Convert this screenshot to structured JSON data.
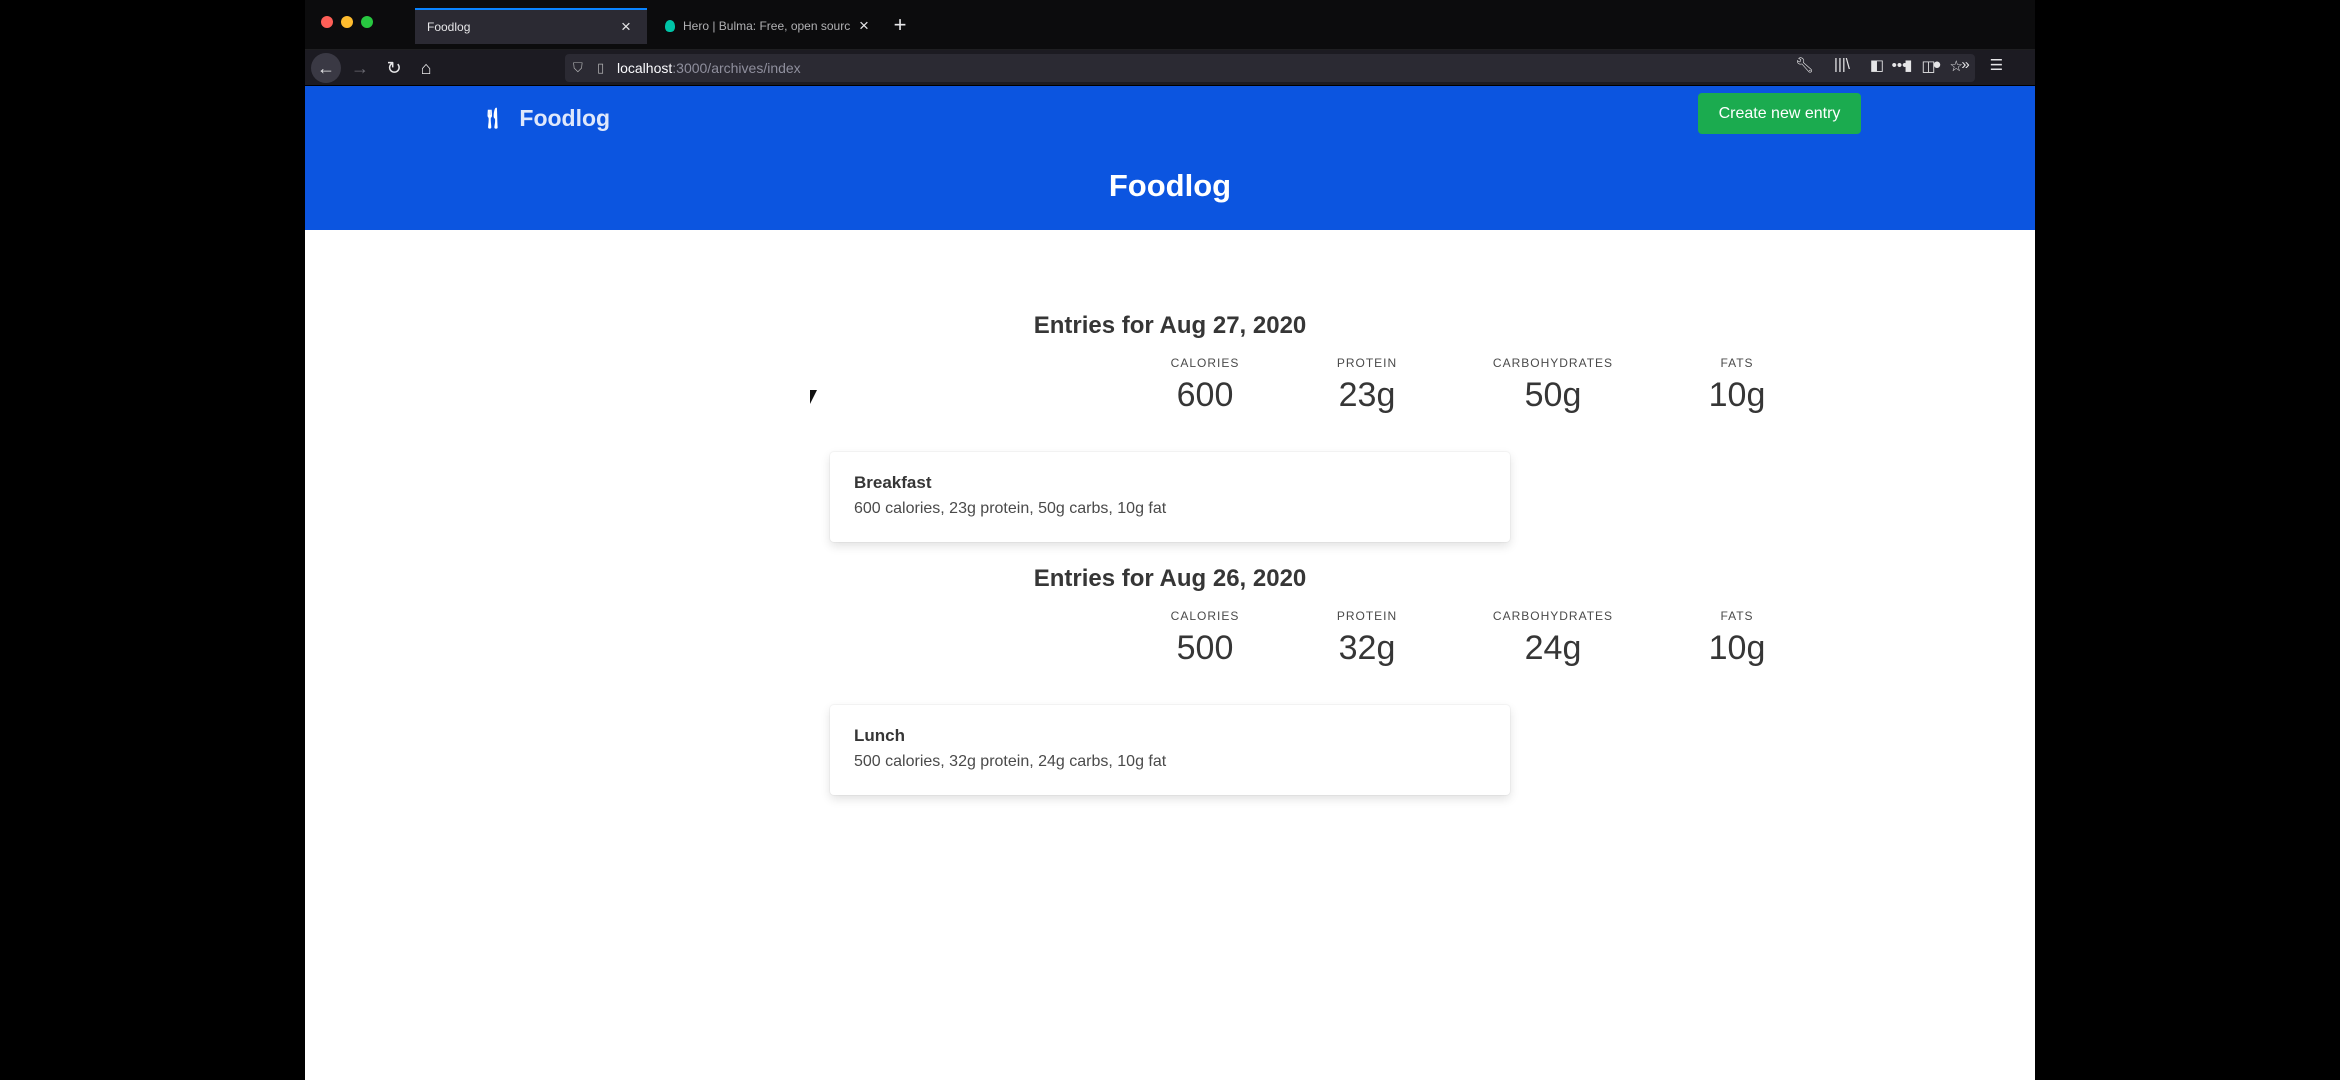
{
  "browser": {
    "tabs": [
      {
        "label": "Foodlog",
        "active": true
      },
      {
        "label": "Hero | Bulma: Free, open sourc",
        "active": false
      }
    ],
    "url_host": "localhost",
    "url_rest": ":3000/archives/index"
  },
  "app": {
    "brand": "Foodlog",
    "create_button": "Create new entry",
    "hero_title": "Foodlog"
  },
  "days": [
    {
      "title": "Entries for Aug 27, 2020",
      "stats": [
        {
          "label": "CALORIES",
          "value": "600"
        },
        {
          "label": "PROTEIN",
          "value": "23g"
        },
        {
          "label": "CARBOHYDRATES",
          "value": "50g"
        },
        {
          "label": "FATS",
          "value": "10g"
        }
      ],
      "entries": [
        {
          "name": "Breakfast",
          "description": "600 calories, 23g protein, 50g carbs, 10g fat"
        }
      ]
    },
    {
      "title": "Entries for Aug 26, 2020",
      "stats": [
        {
          "label": "CALORIES",
          "value": "500"
        },
        {
          "label": "PROTEIN",
          "value": "32g"
        },
        {
          "label": "CARBOHYDRATES",
          "value": "24g"
        },
        {
          "label": "FATS",
          "value": "10g"
        }
      ],
      "entries": [
        {
          "name": "Lunch",
          "description": "500 calories, 32g protein, 24g carbs, 10g fat"
        }
      ]
    }
  ],
  "colors": {
    "hero": "#0c55e0",
    "create_button": "#1bab4f"
  }
}
